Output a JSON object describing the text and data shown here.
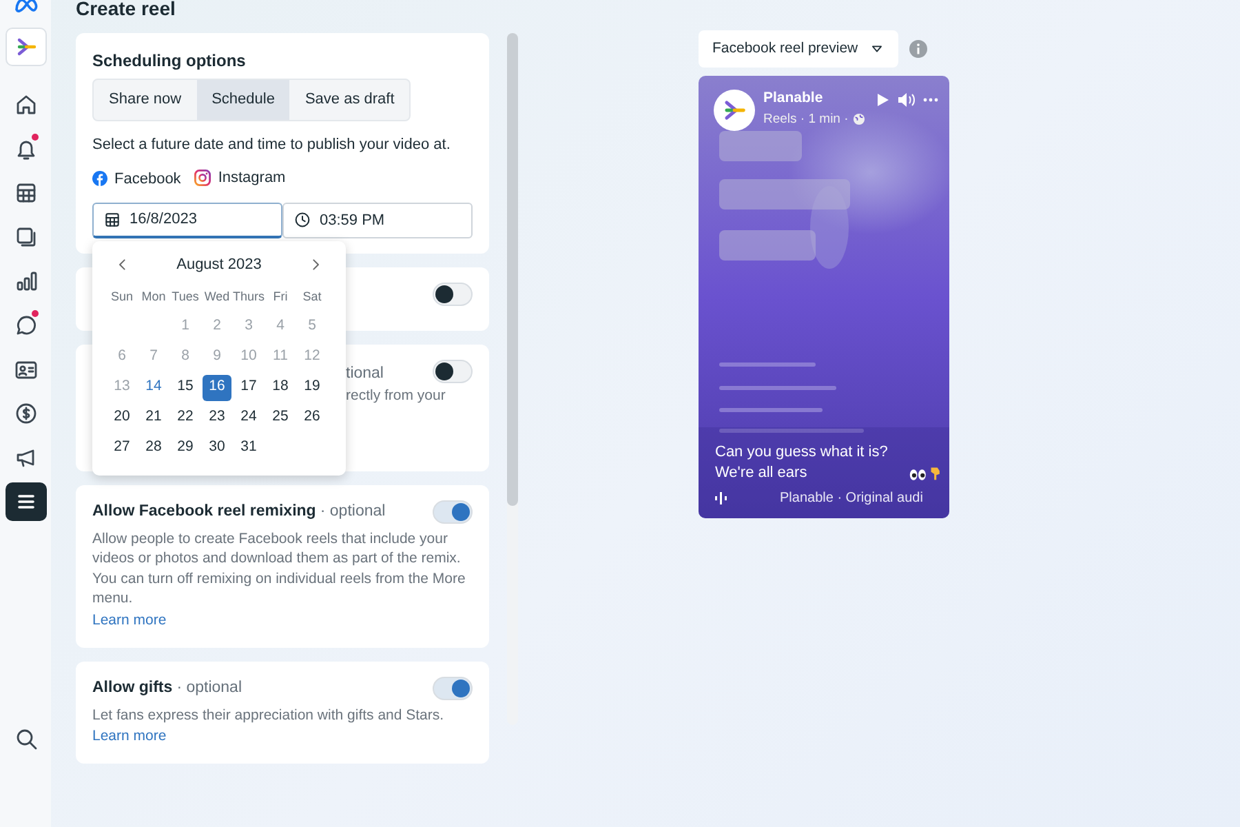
{
  "sidebar": {
    "items": [
      {
        "kind": "meta",
        "selected": false,
        "badge": false
      },
      {
        "kind": "app",
        "selected": false,
        "badge": false
      },
      {
        "kind": "home",
        "selected": false,
        "badge": false
      },
      {
        "kind": "bell",
        "selected": false,
        "badge": true
      },
      {
        "kind": "table",
        "selected": false,
        "badge": false
      },
      {
        "kind": "layers",
        "selected": false,
        "badge": false
      },
      {
        "kind": "chart",
        "selected": false,
        "badge": false
      },
      {
        "kind": "chat",
        "selected": false,
        "badge": true
      },
      {
        "kind": "idcard",
        "selected": false,
        "badge": false
      },
      {
        "kind": "dollar",
        "selected": false,
        "badge": false
      },
      {
        "kind": "megaphone",
        "selected": false,
        "badge": false
      },
      {
        "kind": "menu",
        "selected": true,
        "badge": false
      },
      {
        "kind": "search",
        "selected": false,
        "badge": false
      }
    ]
  },
  "page": {
    "title": "Create reel"
  },
  "scheduling": {
    "title": "Scheduling options",
    "modes": [
      {
        "label": "Share now",
        "selected": false
      },
      {
        "label": "Schedule",
        "selected": true
      },
      {
        "label": "Save as draft",
        "selected": false
      }
    ],
    "instruction": "Select a future date and time to publish your video at.",
    "platforms": [
      {
        "kind": "facebook",
        "label": "Facebook"
      },
      {
        "kind": "instagram",
        "label": "Instagram"
      }
    ],
    "date": {
      "value": "16/8/2023",
      "focused": true
    },
    "time": {
      "value": "03:59 PM",
      "focused": false
    }
  },
  "calendar": {
    "month": "August 2023",
    "weekdays": [
      "Sun",
      "Mon",
      "Tues",
      "Wed",
      "Thurs",
      "Fri",
      "Sat"
    ],
    "weeks": [
      [
        {
          "kind": "blank"
        },
        {
          "kind": "blank"
        },
        {
          "kind": "day",
          "label": "1",
          "muted": true,
          "today": false,
          "selected": false
        },
        {
          "kind": "day",
          "label": "2",
          "muted": true,
          "today": false,
          "selected": false
        },
        {
          "kind": "day",
          "label": "3",
          "muted": true,
          "today": false,
          "selected": false
        },
        {
          "kind": "day",
          "label": "4",
          "muted": true,
          "today": false,
          "selected": false
        },
        {
          "kind": "day",
          "label": "5",
          "muted": true,
          "today": false,
          "selected": false
        }
      ],
      [
        {
          "kind": "day",
          "label": "6",
          "muted": true,
          "today": false,
          "selected": false
        },
        {
          "kind": "day",
          "label": "7",
          "muted": true,
          "today": false,
          "selected": false
        },
        {
          "kind": "day",
          "label": "8",
          "muted": true,
          "today": false,
          "selected": false
        },
        {
          "kind": "day",
          "label": "9",
          "muted": true,
          "today": false,
          "selected": false
        },
        {
          "kind": "day",
          "label": "10",
          "muted": true,
          "today": false,
          "selected": false
        },
        {
          "kind": "day",
          "label": "11",
          "muted": true,
          "today": false,
          "selected": false
        },
        {
          "kind": "day",
          "label": "12",
          "muted": true,
          "today": false,
          "selected": false
        }
      ],
      [
        {
          "kind": "day",
          "label": "13",
          "muted": true,
          "today": false,
          "selected": false
        },
        {
          "kind": "day",
          "label": "14",
          "muted": false,
          "today": true,
          "selected": false
        },
        {
          "kind": "day",
          "label": "15",
          "muted": false,
          "today": false,
          "selected": false
        },
        {
          "kind": "day",
          "label": "16",
          "muted": false,
          "today": false,
          "selected": true
        },
        {
          "kind": "day",
          "label": "17",
          "muted": false,
          "today": false,
          "selected": false
        },
        {
          "kind": "day",
          "label": "18",
          "muted": false,
          "today": false,
          "selected": false
        },
        {
          "kind": "day",
          "label": "19",
          "muted": false,
          "today": false,
          "selected": false
        }
      ],
      [
        {
          "kind": "day",
          "label": "20",
          "muted": false,
          "today": false,
          "selected": false
        },
        {
          "kind": "day",
          "label": "21",
          "muted": false,
          "today": false,
          "selected": false
        },
        {
          "kind": "day",
          "label": "22",
          "muted": false,
          "today": false,
          "selected": false
        },
        {
          "kind": "day",
          "label": "23",
          "muted": false,
          "today": false,
          "selected": false
        },
        {
          "kind": "day",
          "label": "24",
          "muted": false,
          "today": false,
          "selected": false
        },
        {
          "kind": "day",
          "label": "25",
          "muted": false,
          "today": false,
          "selected": false
        },
        {
          "kind": "day",
          "label": "26",
          "muted": false,
          "today": false,
          "selected": false
        }
      ],
      [
        {
          "kind": "day",
          "label": "27",
          "muted": false,
          "today": false,
          "selected": false
        },
        {
          "kind": "day",
          "label": "28",
          "muted": false,
          "today": false,
          "selected": false
        },
        {
          "kind": "day",
          "label": "29",
          "muted": false,
          "today": false,
          "selected": false
        },
        {
          "kind": "day",
          "label": "30",
          "muted": false,
          "today": false,
          "selected": false
        },
        {
          "kind": "day",
          "label": "31",
          "muted": false,
          "today": false,
          "selected": false
        }
      ]
    ]
  },
  "settings": [
    {
      "kind": "covered",
      "on": false
    },
    {
      "kind": "covered",
      "tag": "tional",
      "description": "rectly from your",
      "on": false
    },
    {
      "kind": "full",
      "title": "Allow Facebook reel remixing",
      "tag": "· optional",
      "description": "Allow people to create Facebook reels that include your videos or photos and download them as part of the remix. You can turn off remixing on individual reels from the More menu.",
      "link": "Learn more",
      "on": true
    },
    {
      "kind": "full",
      "title": "Allow gifts",
      "tag": "· optional",
      "description": "Let fans express their appreciation with gifts and Stars.",
      "link": "Learn more",
      "on": true
    }
  ],
  "preview": {
    "selector": "Facebook reel preview",
    "video": {
      "kind": "picture",
      "account": "Planable",
      "meta": "Reels · 1 min ·",
      "caption": "Can you guess what it is? We're all ears",
      "audio": "Planable · Original audi"
    }
  }
}
